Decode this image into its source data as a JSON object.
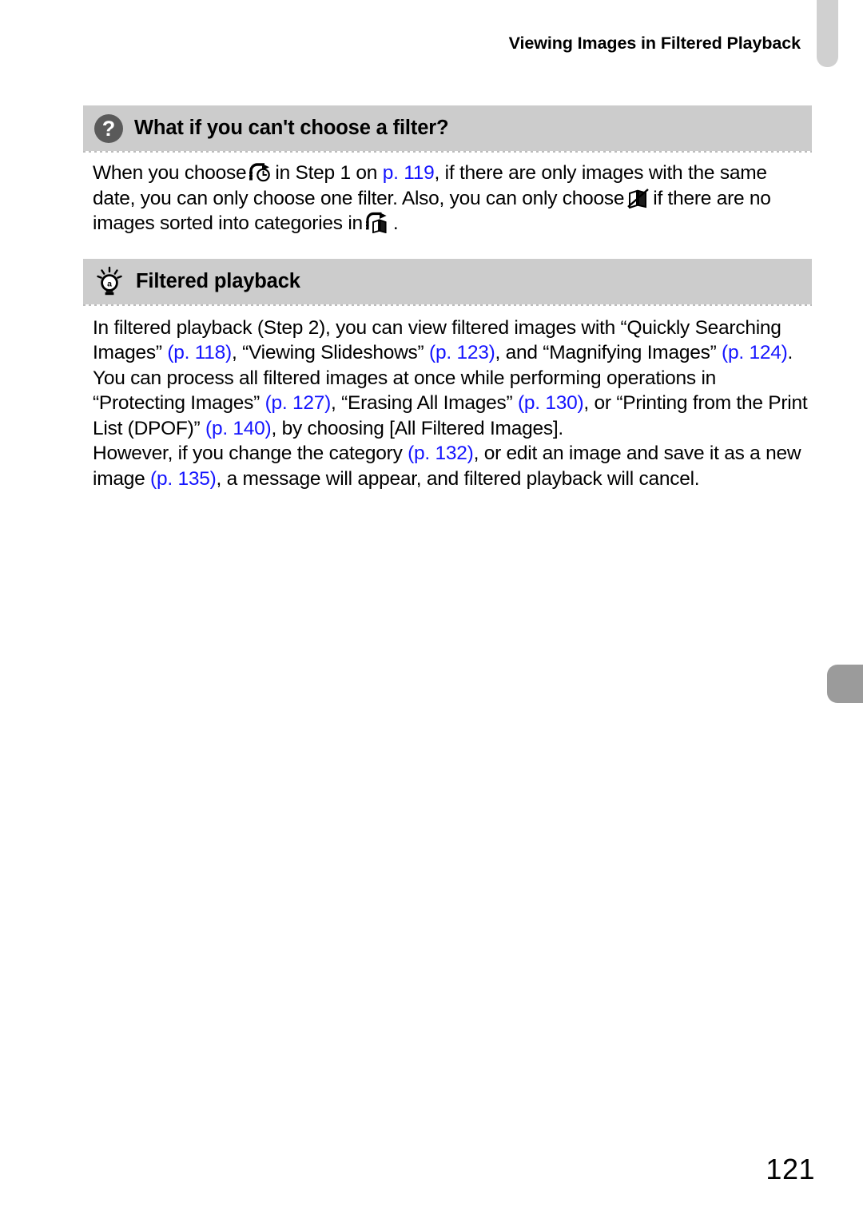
{
  "document": {
    "running_head": "Viewing Images in Filtered Playback",
    "page_number": "121"
  },
  "colors": {
    "callout_header_bg": "#cccccc",
    "question_badge": "#5a5a5a",
    "reference_link": "#1414ff",
    "tab_top": "#d0d0d0",
    "tab_side": "#9b9b9b",
    "text": "#000000"
  },
  "callouts": [
    {
      "icon": "question-mark-icon",
      "title": "What if you can't choose a filter?",
      "body": {
        "seg1": "When you choose",
        "icon1": "filter-by-shoot-date-icon",
        "seg2": "in Step 1 on",
        "ref1": "p. 119",
        "seg3": ", if there are only images with the same date, you can only choose one filter. Also, you can only choose",
        "icon2": "no-category-icon",
        "seg4": "if there are no images sorted into categories in",
        "icon3": "filter-by-category-icon",
        "seg5": "."
      }
    },
    {
      "icon": "light-bulb-icon",
      "title": "Filtered playback",
      "body": {
        "seg1": "In filtered playback (Step 2), you can view filtered images with “Quickly Searching Images”",
        "ref1": "(p. 118)",
        "seg2": ", “Viewing Slideshows”",
        "ref2": "(p. 123)",
        "seg3": ", and “Magnifying Images”",
        "ref3": "(p. 124)",
        "seg4": ". You can process all filtered images at once while performing operations in “Protecting Images”",
        "ref4": "(p. 127)",
        "seg5": ", “Erasing All Images”",
        "ref5": "(p. 130)",
        "seg6": ", or “Printing from the Print List (DPOF)”",
        "ref6": "(p. 140)",
        "seg7": ", by choosing [All Filtered Images].",
        "seg8": "However, if you change the category",
        "ref7": "(p. 132)",
        "seg9": ", or edit an image and save it as a new image",
        "ref8": "(p. 135)",
        "seg10": ", a message will appear, and filtered playback will cancel."
      }
    }
  ],
  "tabs": [
    {
      "name": "top-thumb-tab"
    },
    {
      "name": "side-thumb-tab"
    }
  ]
}
